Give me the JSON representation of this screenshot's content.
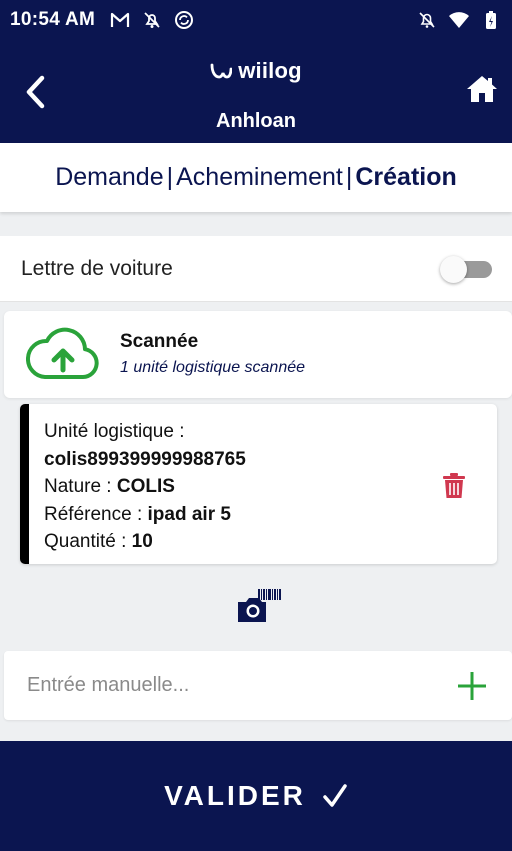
{
  "status_bar": {
    "time": "10:54 AM",
    "left_icons": [
      "gmail-icon",
      "mute-icon",
      "sync-icon"
    ],
    "right_icons": [
      "notifications-off-icon",
      "wifi-icon",
      "battery-icon"
    ]
  },
  "header": {
    "logo_text": "wiilog",
    "title": "Anhloan",
    "back_icon": "chevron-left-icon",
    "home_icon": "home-icon"
  },
  "steps": {
    "items": [
      "Demande",
      "Acheminement",
      "Création"
    ],
    "separator": "|",
    "active_index": 2
  },
  "lettre": {
    "label": "Lettre de voiture",
    "toggle_on": false
  },
  "scan": {
    "title": "Scannée",
    "subtitle": "1 unité logistique scannée",
    "icon": "cloud-upload-icon",
    "icon_color": "#2aa33a"
  },
  "item": {
    "unite_label": "Unité logistique :",
    "unite_value": "colis899399999988765",
    "nature_label": "Nature :",
    "nature_value": "COLIS",
    "reference_label": "Référence :",
    "reference_value": "ipad air 5",
    "quantite_label": "Quantité :",
    "quantite_value": "10",
    "delete_icon": "trash-icon",
    "delete_color": "#d0384f"
  },
  "camera": {
    "icon": "barcode-camera-icon"
  },
  "manual": {
    "placeholder": "Entrée manuelle...",
    "value": "",
    "add_icon": "plus-icon"
  },
  "footer": {
    "validate_label": "VALIDER",
    "validate_icon": "check-icon"
  },
  "colors": {
    "primary": "#0b1550",
    "success": "#2aa33a",
    "danger": "#d0384f"
  }
}
